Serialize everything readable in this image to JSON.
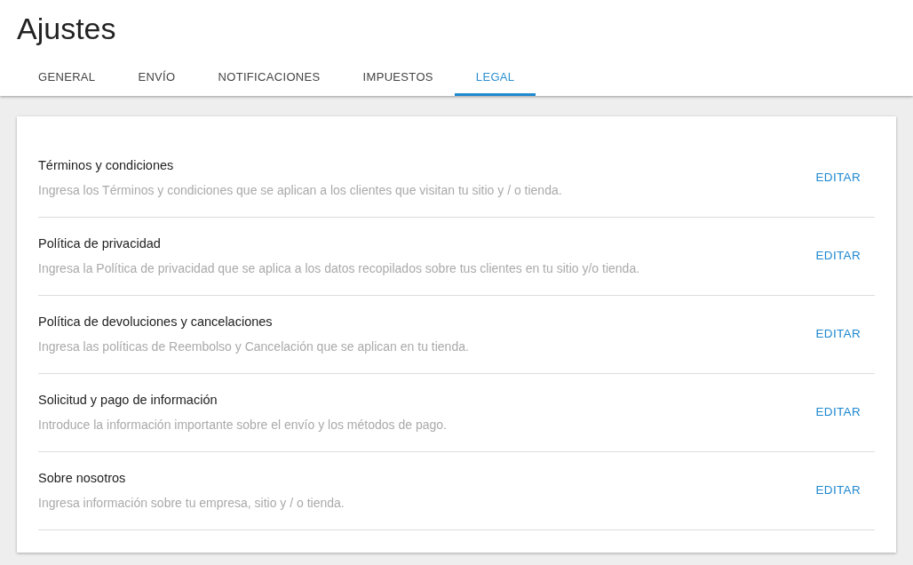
{
  "title": "Ajustes",
  "tabs": [
    {
      "label": "GENERAL",
      "selected": false
    },
    {
      "label": "ENVÍO",
      "selected": false
    },
    {
      "label": "NOTIFICACIONES",
      "selected": false
    },
    {
      "label": "IMPUESTOS",
      "selected": false
    },
    {
      "label": "LEGAL",
      "selected": true
    }
  ],
  "sections": [
    {
      "title": "Términos y condiciones",
      "description": "Ingresa los Términos y condiciones que se aplican a los clientes que visitan tu sitio y / o tienda.",
      "action": "EDITAR"
    },
    {
      "title": "Política de privacidad",
      "description": "Ingresa la Política de privacidad que se aplica a los datos recopilados sobre tus clientes en tu sitio y/o tienda.",
      "action": "EDITAR"
    },
    {
      "title": "Política de devoluciones y cancelaciones",
      "description": "Ingresa las políticas de Reembolso y Cancelación que se aplican en tu tienda.",
      "action": "EDITAR"
    },
    {
      "title": "Solicitud y pago de información",
      "description": "Introduce la información importante sobre el envío y los métodos de pago.",
      "action": "EDITAR"
    },
    {
      "title": "Sobre nosotros",
      "description": "Ingresa información sobre tu empresa, sitio y / o tienda.",
      "action": "EDITAR"
    }
  ]
}
